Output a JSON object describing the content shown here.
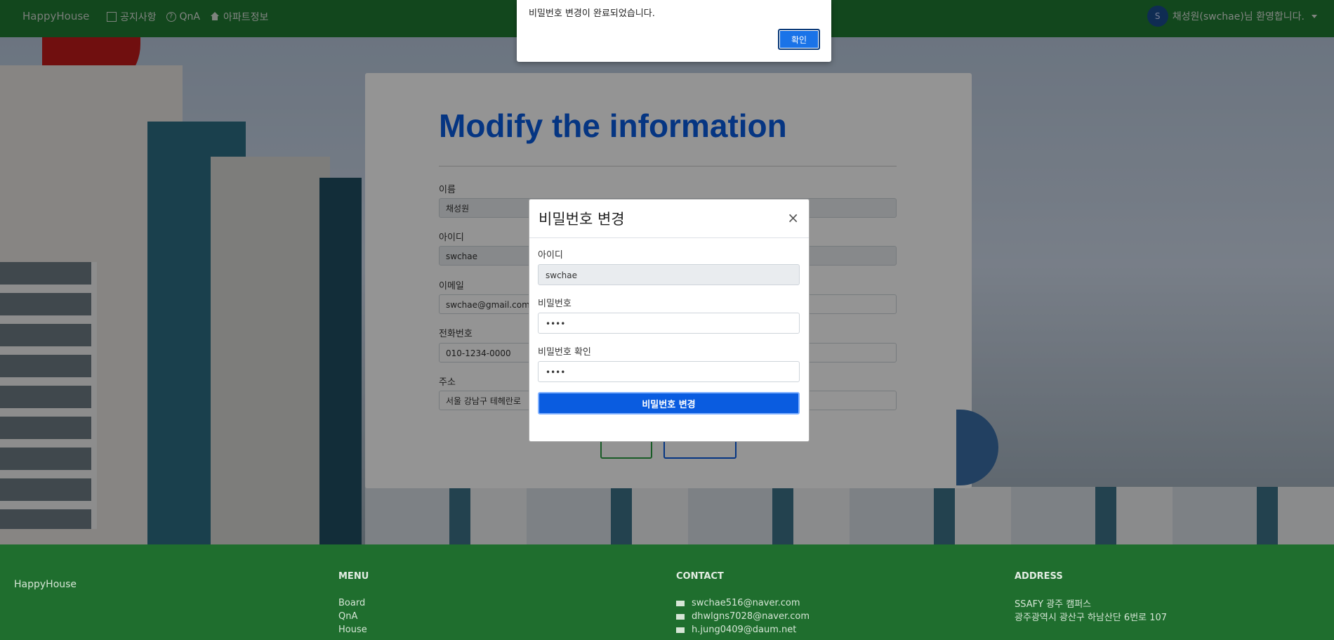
{
  "navbar": {
    "brand": "HappyHouse",
    "links": [
      {
        "label": "공지사항",
        "icon": "square-icon"
      },
      {
        "label": "QnA",
        "icon": "question-icon"
      },
      {
        "label": "아파트정보",
        "icon": "home-icon"
      }
    ],
    "user": {
      "avatar_letter": "S",
      "greeting": "채성원(swchae)님 환영합니다."
    }
  },
  "form": {
    "title": "Modify the information",
    "fields": [
      {
        "label": "이름",
        "value": "채성원"
      },
      {
        "label": "아이디",
        "value": "swchae"
      },
      {
        "label": "이메일",
        "value": "swchae@gmail.com"
      },
      {
        "label": "전화번호",
        "value": "010-1234-0000"
      },
      {
        "label": "주소",
        "value": "서울 강남구 테헤란로"
      }
    ]
  },
  "modal": {
    "title": "비밀번호 변경",
    "close": "×",
    "id_label": "아이디",
    "id_value": "swchae",
    "pw_label": "비밀번호",
    "pw_value": "••••",
    "pw_confirm_label": "비밀번호 확인",
    "pw_confirm_value": "••••",
    "submit": "비밀번호 변경"
  },
  "alert": {
    "message": "비밀번호 변경이 완료되었습니다.",
    "ok": "확인"
  },
  "footer": {
    "brand": "HappyHouse",
    "menu": {
      "heading": "MENU",
      "items": [
        "Board",
        "QnA",
        "House"
      ]
    },
    "contact": {
      "heading": "CONTACT",
      "items": [
        "swchae516@naver.com",
        "dhwlgns7028@naver.com",
        "h.jung0409@daum.net"
      ]
    },
    "address": {
      "heading": "ADDRESS",
      "lines": [
        "SSAFY 광주 캠퍼스",
        "광주광역시 광산구 하남산단 6번로 107"
      ]
    }
  }
}
